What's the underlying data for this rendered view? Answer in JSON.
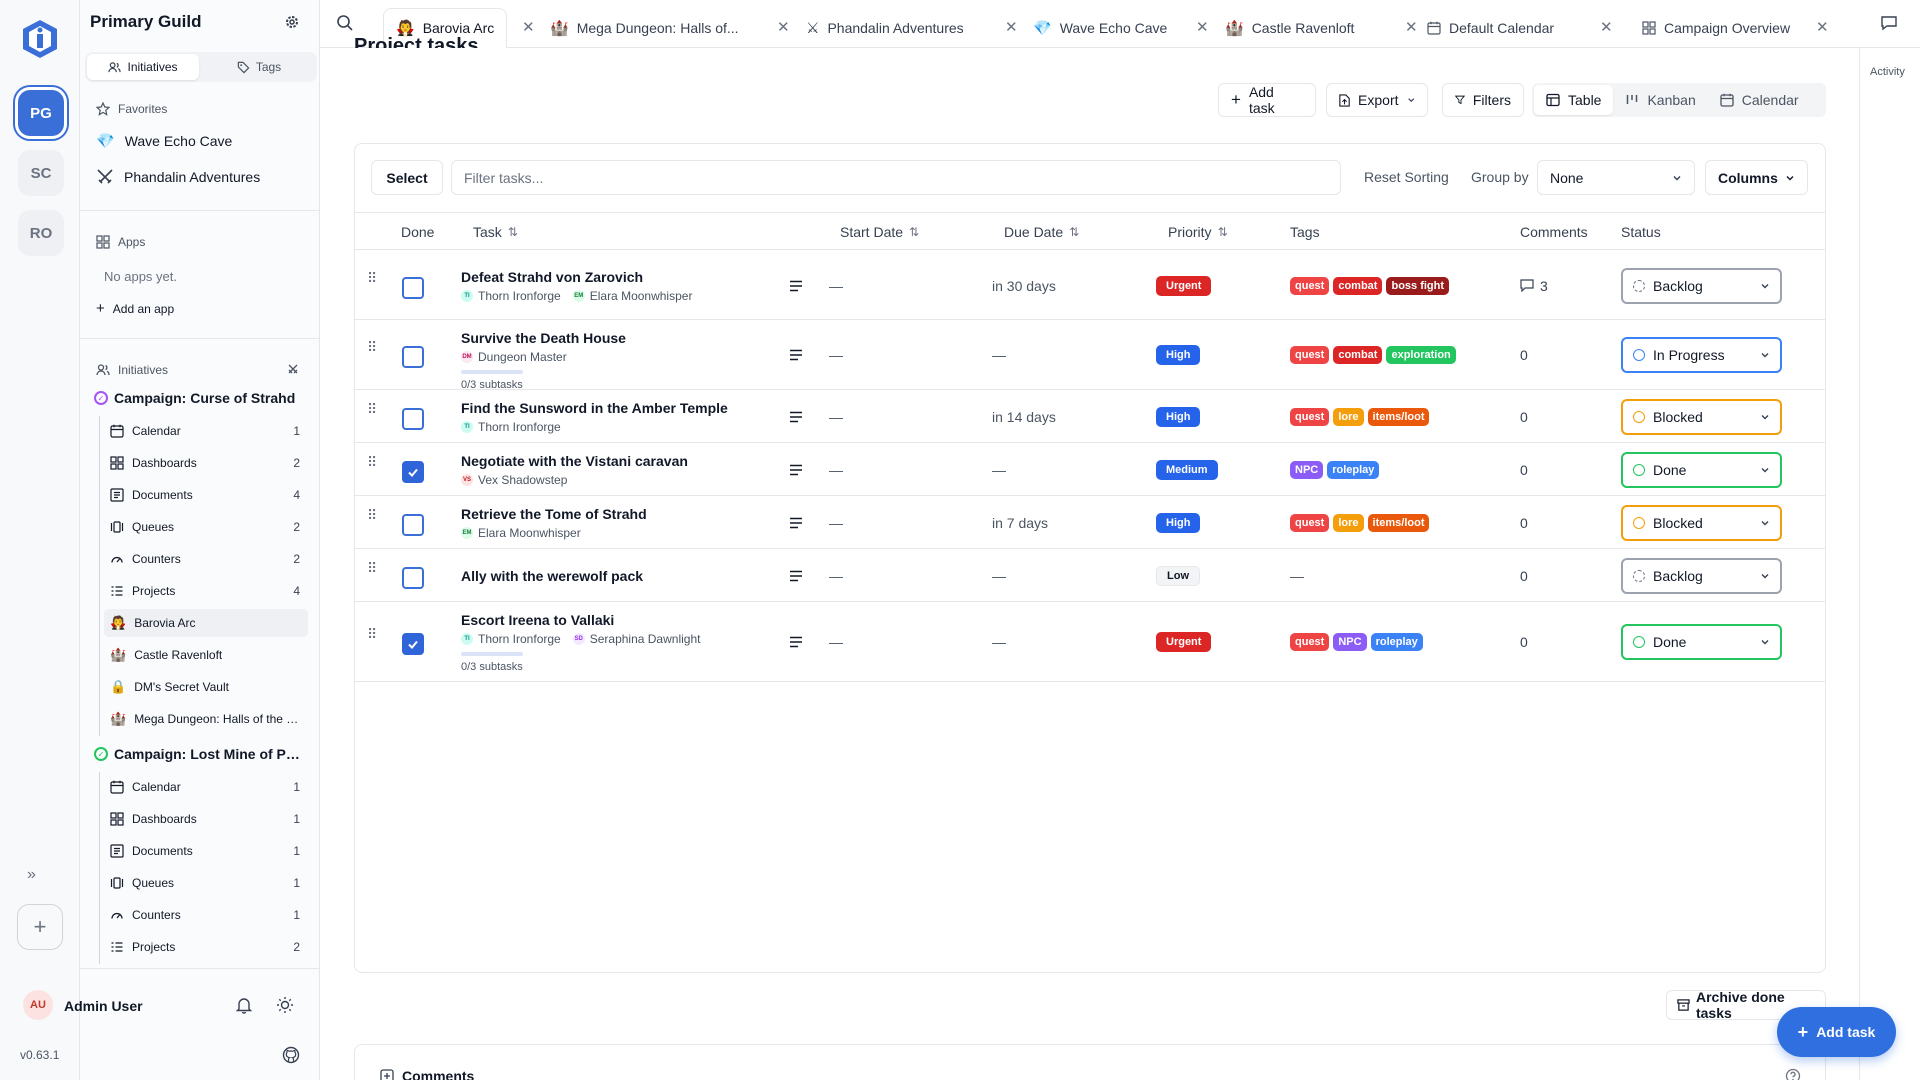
{
  "rail": {
    "avatars": [
      "PG",
      "SC",
      "RO"
    ],
    "expand_glyph": "»",
    "add_glyph": "+"
  },
  "sidebar": {
    "title": "Primary Guild",
    "tabs": [
      "Initiatives",
      "Tags"
    ],
    "favorites_label": "Favorites",
    "favorites": [
      {
        "label": "Wave Echo Cave",
        "icon": "gem-icon"
      },
      {
        "label": "Phandalin Adventures",
        "icon": "crossed-swords-icon"
      }
    ],
    "apps_label": "Apps",
    "no_apps": "No apps yet.",
    "add_app": "Add an app",
    "initiatives_label": "Initiatives",
    "campaigns": [
      {
        "name": "Campaign: Curse of Strahd",
        "color": "#a855f7",
        "items": [
          {
            "label": "Calendar",
            "count": "1",
            "icon": "calendar-icon"
          },
          {
            "label": "Dashboards",
            "count": "2",
            "icon": "dashboard-icon"
          },
          {
            "label": "Documents",
            "count": "4",
            "icon": "documents-icon"
          },
          {
            "label": "Queues",
            "count": "2",
            "icon": "queue-icon"
          },
          {
            "label": "Counters",
            "count": "2",
            "icon": "gauge-icon"
          },
          {
            "label": "Projects",
            "count": "4",
            "icon": "projects-icon"
          },
          {
            "label": "Barovia Arc",
            "count": "",
            "icon": "vampire-emoji"
          },
          {
            "label": "Castle Ravenloft",
            "count": "",
            "icon": "castle-emoji"
          },
          {
            "label": "DM's Secret Vault",
            "count": "",
            "icon": "lock-emoji"
          },
          {
            "label": "Mega Dungeon: Halls of the Undead King",
            "count": "",
            "icon": "castle-emoji"
          }
        ]
      },
      {
        "name": "Campaign: Lost Mine of Phandelver",
        "color": "#22c55e",
        "items": [
          {
            "label": "Calendar",
            "count": "1",
            "icon": "calendar-icon"
          },
          {
            "label": "Dashboards",
            "count": "1",
            "icon": "dashboard-icon"
          },
          {
            "label": "Documents",
            "count": "1",
            "icon": "documents-icon"
          },
          {
            "label": "Queues",
            "count": "1",
            "icon": "queue-icon"
          },
          {
            "label": "Counters",
            "count": "1",
            "icon": "gauge-icon"
          },
          {
            "label": "Projects",
            "count": "2",
            "icon": "projects-icon"
          }
        ]
      }
    ],
    "user": {
      "initials": "AU",
      "name": "Admin User"
    },
    "version": "v0.63.1"
  },
  "tabs": [
    {
      "label": "Barovia Arc",
      "emoji": "🧛"
    },
    {
      "label": "Mega Dungeon: Halls of...",
      "emoji": "🏰"
    },
    {
      "label": "Phandalin Adventures",
      "emoji": "⚔"
    },
    {
      "label": "Wave Echo Cave",
      "emoji": "💎"
    },
    {
      "label": "Castle Ravenloft",
      "emoji": "🏰"
    },
    {
      "label": "Default Calendar",
      "emoji": ""
    },
    {
      "label": "Campaign Overview",
      "emoji": ""
    }
  ],
  "right_rail": {
    "activity": "Activity"
  },
  "main": {
    "title": "Project tasks",
    "add_task": "Add task",
    "export": "Export",
    "filters": "Filters",
    "views": [
      "Table",
      "Kanban",
      "Calendar"
    ],
    "select": "Select",
    "filter_placeholder": "Filter tasks...",
    "reset_sorting": "Reset Sorting",
    "group_by_label": "Group by",
    "group_by_value": "None",
    "columns": "Columns",
    "headers": [
      "Done",
      "Task",
      "Start Date",
      "Due Date",
      "Priority",
      "Tags",
      "Comments",
      "Status"
    ],
    "rows": [
      {
        "done": false,
        "name": "Defeat Strahd von Zarovich",
        "assignees": [
          {
            "i": "TI",
            "n": "Thorn Ironforge",
            "c": "#0d9488",
            "b": "#ccfbf1"
          },
          {
            "i": "EM",
            "n": "Elara Moonwhisper",
            "c": "#15803d",
            "b": "#dcfce7"
          }
        ],
        "subtasks": "",
        "start": "—",
        "due": "in 30 days",
        "priority": "Urgent",
        "tags": [
          "quest",
          "combat",
          "boss fight"
        ],
        "comments": "3",
        "status": "Backlog"
      },
      {
        "done": false,
        "name": "Survive the Death House",
        "assignees": [
          {
            "i": "DM",
            "n": "Dungeon Master",
            "c": "#be185d",
            "b": "#fce7f3"
          }
        ],
        "subtasks": "0/3 subtasks",
        "start": "—",
        "due": "—",
        "priority": "High",
        "tags": [
          "quest",
          "combat",
          "exploration"
        ],
        "comments": "0",
        "status": "In Progress"
      },
      {
        "done": false,
        "name": "Find the Sunsword in the Amber Temple",
        "assignees": [
          {
            "i": "TI",
            "n": "Thorn Ironforge",
            "c": "#0d9488",
            "b": "#ccfbf1"
          }
        ],
        "subtasks": "",
        "start": "—",
        "due": "in 14 days",
        "priority": "High",
        "tags": [
          "quest",
          "lore",
          "items/loot"
        ],
        "comments": "0",
        "status": "Blocked"
      },
      {
        "done": true,
        "name": "Negotiate with the Vistani caravan",
        "assignees": [
          {
            "i": "VS",
            "n": "Vex Shadowstep",
            "c": "#b91c1c",
            "b": "#fee2e2"
          }
        ],
        "subtasks": "",
        "start": "—",
        "due": "—",
        "priority": "Medium",
        "tags": [
          "NPC",
          "roleplay"
        ],
        "comments": "0",
        "status": "Done"
      },
      {
        "done": false,
        "name": "Retrieve the Tome of Strahd",
        "assignees": [
          {
            "i": "EM",
            "n": "Elara Moonwhisper",
            "c": "#15803d",
            "b": "#dcfce7"
          }
        ],
        "subtasks": "",
        "start": "—",
        "due": "in 7 days",
        "priority": "High",
        "tags": [
          "quest",
          "lore",
          "items/loot"
        ],
        "comments": "0",
        "status": "Blocked"
      },
      {
        "done": false,
        "name": "Ally with the werewolf pack",
        "assignees": [],
        "subtasks": "",
        "start": "—",
        "due": "—",
        "priority": "Low",
        "tags": [],
        "tags_empty": "—",
        "comments": "0",
        "status": "Backlog"
      },
      {
        "done": true,
        "name": "Escort Ireena to Vallaki",
        "assignees": [
          {
            "i": "TI",
            "n": "Thorn Ironforge",
            "c": "#0d9488",
            "b": "#ccfbf1"
          },
          {
            "i": "SD",
            "n": "Seraphina Dawnlight",
            "c": "#9333ea",
            "b": "#f3e8ff"
          }
        ],
        "subtasks": "0/3 subtasks",
        "start": "—",
        "due": "—",
        "priority": "Urgent",
        "tags": [
          "quest",
          "NPC",
          "roleplay"
        ],
        "comments": "0",
        "status": "Done"
      }
    ],
    "archive_done": "Archive done tasks",
    "fab_add_task": "Add task",
    "comments_title": "Comments"
  },
  "colors": {
    "priority": {
      "Urgent": [
        "#dc2626",
        "#ffffff"
      ],
      "High": [
        "#2563eb",
        "#ffffff"
      ],
      "Medium": [
        "#2563eb",
        "#ffffff"
      ],
      "Low": [
        "#f3f4f6",
        "#111827"
      ]
    },
    "tags": {
      "quest": "#ef4444",
      "combat": "#dc2626",
      "boss fight": "#991b1b",
      "exploration": "#22c55e",
      "lore": "#f59e0b",
      "items/loot": "#ea580c",
      "NPC": "#8b5cf6",
      "roleplay": "#3b82f6"
    },
    "status": {
      "Backlog": "#6b7280",
      "In Progress": "#3b82f6",
      "Blocked": "#f59e0b",
      "Done": "#22c55e"
    },
    "accent": "#2f6fe0"
  }
}
